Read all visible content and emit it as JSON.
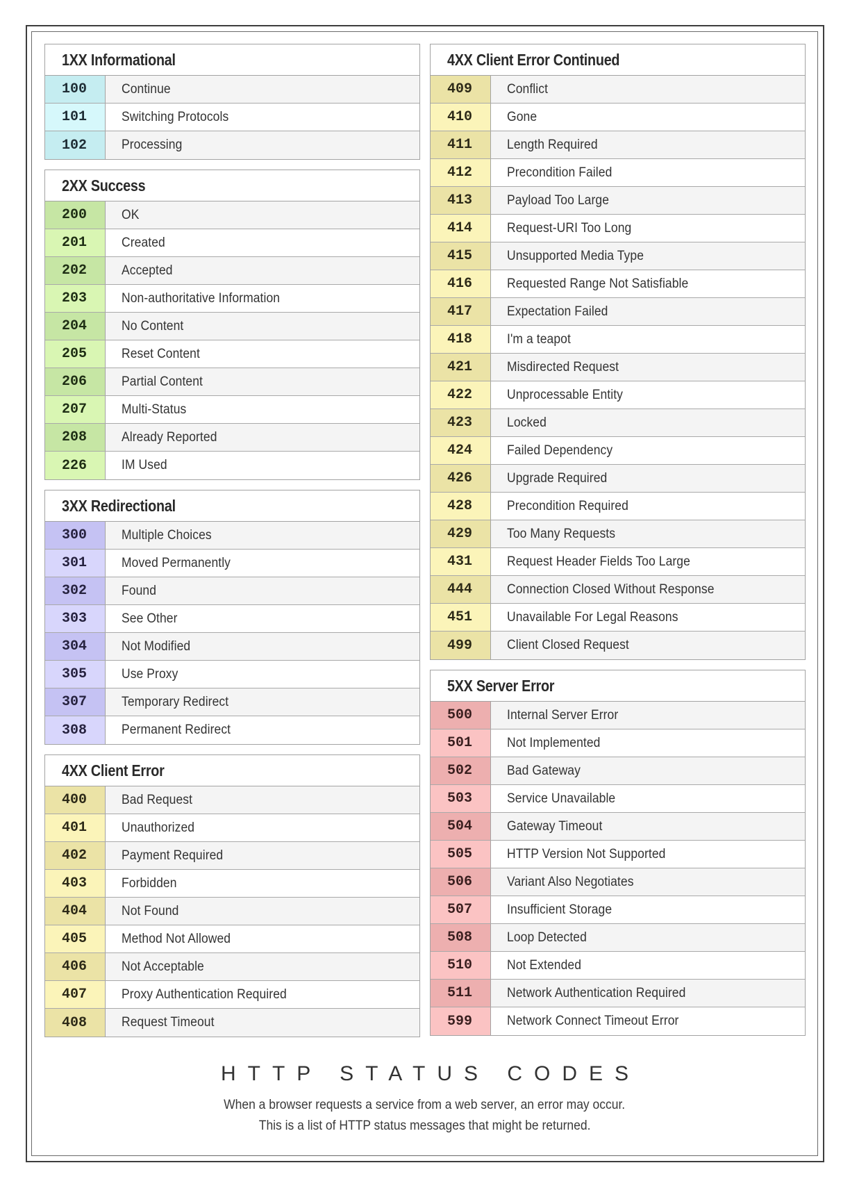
{
  "title": "HTTP STATUS CODES",
  "subtitle_lines": [
    "When a browser requests a service from a web server, an error may occur.",
    "This is a list of HTTP status messages that might be returned."
  ],
  "colors": {
    "informational": [
      "#c5edf1",
      "#d6f8fb"
    ],
    "success": [
      "#c6e6a4",
      "#d9f6b3"
    ],
    "redirectional": [
      "#c5c2f3",
      "#d8d6fc"
    ],
    "client_error": [
      "#ebe3a6",
      "#fbf4b9"
    ],
    "server_error": [
      "#edafaf",
      "#fbc3c3"
    ]
  },
  "sections": {
    "s1xx": {
      "title": "1XX Informational",
      "rows": [
        {
          "code": "100",
          "desc": "Continue"
        },
        {
          "code": "101",
          "desc": "Switching Protocols"
        },
        {
          "code": "102",
          "desc": "Processing"
        }
      ]
    },
    "s2xx": {
      "title": "2XX Success",
      "rows": [
        {
          "code": "200",
          "desc": "OK"
        },
        {
          "code": "201",
          "desc": "Created"
        },
        {
          "code": "202",
          "desc": "Accepted"
        },
        {
          "code": "203",
          "desc": "Non-authoritative Information"
        },
        {
          "code": "204",
          "desc": "No Content"
        },
        {
          "code": "205",
          "desc": "Reset Content"
        },
        {
          "code": "206",
          "desc": "Partial Content"
        },
        {
          "code": "207",
          "desc": "Multi-Status"
        },
        {
          "code": "208",
          "desc": "Already Reported"
        },
        {
          "code": "226",
          "desc": "IM Used"
        }
      ]
    },
    "s3xx": {
      "title": "3XX Redirectional",
      "rows": [
        {
          "code": "300",
          "desc": "Multiple Choices"
        },
        {
          "code": "301",
          "desc": "Moved Permanently"
        },
        {
          "code": "302",
          "desc": "Found"
        },
        {
          "code": "303",
          "desc": "See Other"
        },
        {
          "code": "304",
          "desc": "Not Modified"
        },
        {
          "code": "305",
          "desc": "Use Proxy"
        },
        {
          "code": "307",
          "desc": "Temporary Redirect"
        },
        {
          "code": "308",
          "desc": "Permanent Redirect"
        }
      ]
    },
    "s4xx": {
      "title": "4XX Client Error",
      "rows": [
        {
          "code": "400",
          "desc": "Bad Request"
        },
        {
          "code": "401",
          "desc": "Unauthorized"
        },
        {
          "code": "402",
          "desc": "Payment Required"
        },
        {
          "code": "403",
          "desc": "Forbidden"
        },
        {
          "code": "404",
          "desc": "Not Found"
        },
        {
          "code": "405",
          "desc": "Method Not Allowed"
        },
        {
          "code": "406",
          "desc": "Not Acceptable"
        },
        {
          "code": "407",
          "desc": "Proxy Authentication Required"
        },
        {
          "code": "408",
          "desc": "Request Timeout"
        }
      ]
    },
    "s4xx_cont": {
      "title": "4XX Client Error Continued",
      "rows": [
        {
          "code": "409",
          "desc": "Conflict"
        },
        {
          "code": "410",
          "desc": "Gone"
        },
        {
          "code": "411",
          "desc": "Length Required"
        },
        {
          "code": "412",
          "desc": "Precondition Failed"
        },
        {
          "code": "413",
          "desc": "Payload Too Large"
        },
        {
          "code": "414",
          "desc": "Request-URI Too Long"
        },
        {
          "code": "415",
          "desc": "Unsupported Media Type"
        },
        {
          "code": "416",
          "desc": "Requested Range Not Satisfiable"
        },
        {
          "code": "417",
          "desc": "Expectation Failed"
        },
        {
          "code": "418",
          "desc": "I'm a teapot"
        },
        {
          "code": "421",
          "desc": "Misdirected Request"
        },
        {
          "code": "422",
          "desc": "Unprocessable Entity"
        },
        {
          "code": "423",
          "desc": "Locked"
        },
        {
          "code": "424",
          "desc": "Failed Dependency"
        },
        {
          "code": "426",
          "desc": "Upgrade Required"
        },
        {
          "code": "428",
          "desc": "Precondition Required"
        },
        {
          "code": "429",
          "desc": "Too Many Requests"
        },
        {
          "code": "431",
          "desc": "Request Header Fields Too Large"
        },
        {
          "code": "444",
          "desc": "Connection Closed Without Response"
        },
        {
          "code": "451",
          "desc": "Unavailable For Legal Reasons"
        },
        {
          "code": "499",
          "desc": "Client Closed Request"
        }
      ]
    },
    "s5xx": {
      "title": "5XX Server Error",
      "rows": [
        {
          "code": "500",
          "desc": "Internal Server Error"
        },
        {
          "code": "501",
          "desc": "Not Implemented"
        },
        {
          "code": "502",
          "desc": "Bad Gateway"
        },
        {
          "code": "503",
          "desc": "Service Unavailable"
        },
        {
          "code": "504",
          "desc": "Gateway Timeout"
        },
        {
          "code": "505",
          "desc": "HTTP Version Not Supported"
        },
        {
          "code": "506",
          "desc": "Variant Also Negotiates"
        },
        {
          "code": "507",
          "desc": "Insufficient Storage"
        },
        {
          "code": "508",
          "desc": "Loop Detected"
        },
        {
          "code": "510",
          "desc": "Not Extended"
        },
        {
          "code": "511",
          "desc": "Network Authentication Required"
        },
        {
          "code": "599",
          "desc": "Network Connect Timeout Error"
        }
      ]
    }
  }
}
